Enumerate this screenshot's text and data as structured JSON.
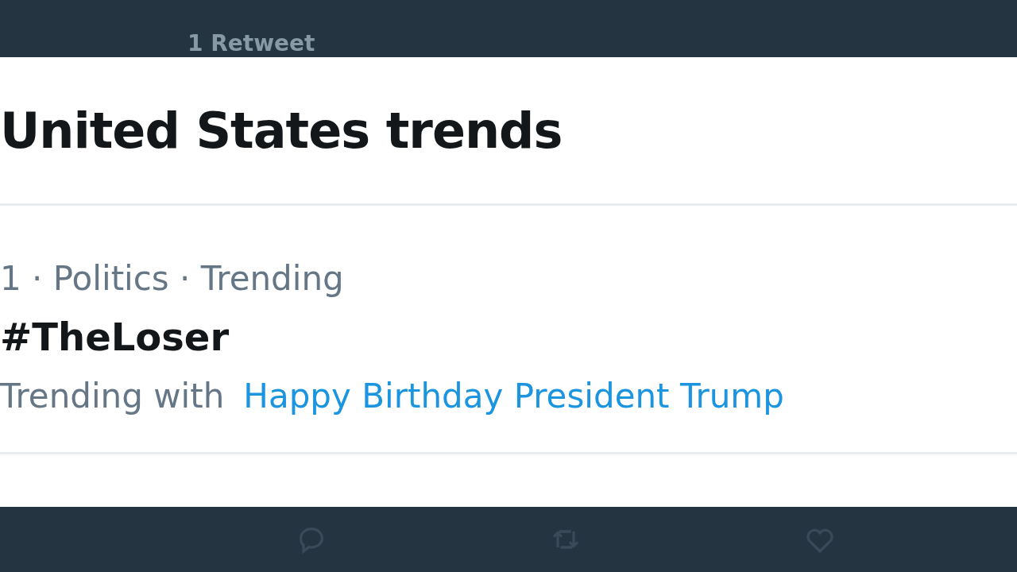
{
  "background_tweet": {
    "retweet_count": "1 Retweet"
  },
  "trends_panel": {
    "title": "United States trends",
    "trends": [
      {
        "meta": "1 · Politics · Trending",
        "name": "#TheLoser",
        "trending_with_label": "Trending with",
        "trending_with_link": "Happy Birthday President Trump"
      }
    ]
  }
}
